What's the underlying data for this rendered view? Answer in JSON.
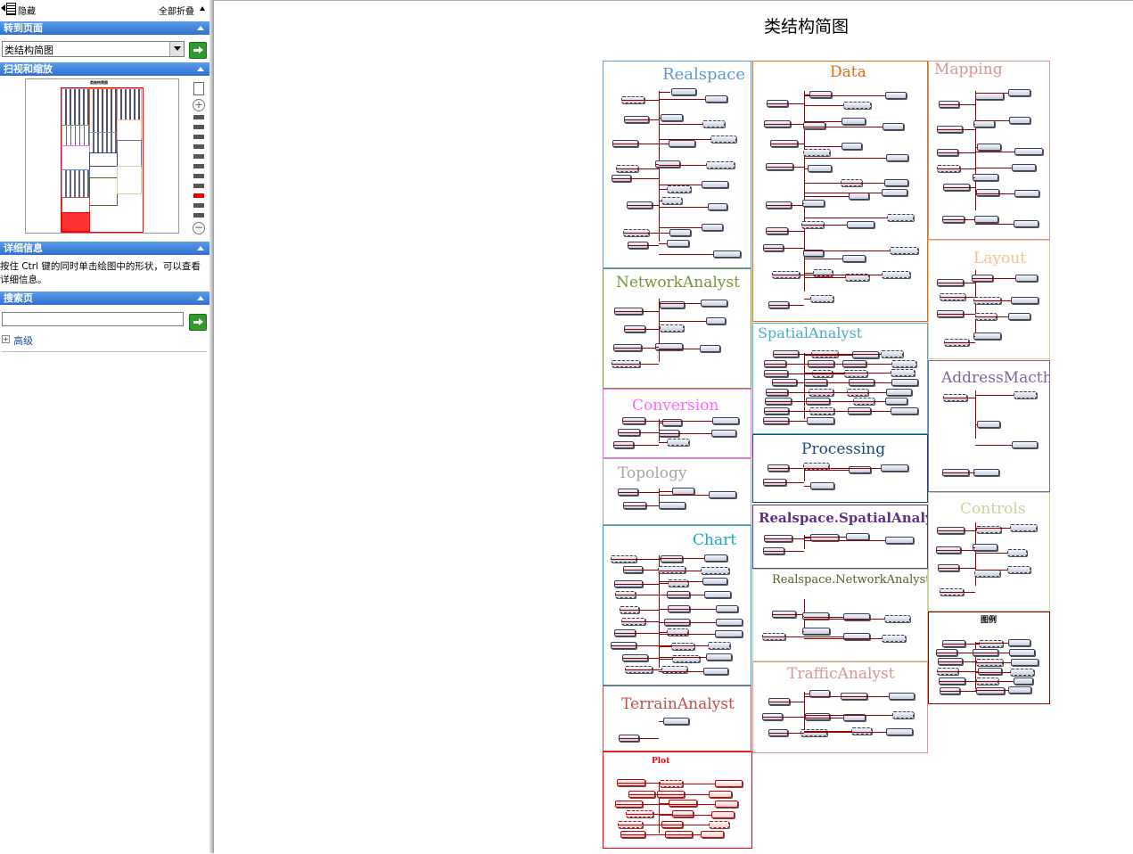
{
  "topbar": {
    "hide_label": "隐藏",
    "collapse_all_label": "全部折叠"
  },
  "goto_section": {
    "header": "转到页面",
    "selected_page": "类结构简图"
  },
  "scan_section": {
    "header": "扫视和缩放",
    "thumb_title": "类结构简图"
  },
  "detail_section": {
    "header": "详细信息",
    "help_text": "按住 Ctrl 键的同时单击绘图中的形状，可以查看详细信息。"
  },
  "search_section": {
    "header": "搜索页",
    "query": "",
    "advanced_label": "高级"
  },
  "diagram": {
    "title": "类结构简图",
    "panels": [
      {
        "name": "Realspace",
        "color": "#5b9bd5"
      },
      {
        "name": "Data",
        "color": "#e36c0a"
      },
      {
        "name": "Mapping",
        "color": "#d99694"
      },
      {
        "name": "NetworkAnalyst",
        "color": "#77933c"
      },
      {
        "name": "Layout",
        "color": "#fabf8f"
      },
      {
        "name": "SpatialAnalyst",
        "color": "#4bacc6"
      },
      {
        "name": "AddressMacth",
        "color": "#8064a2"
      },
      {
        "name": "Conversion",
        "color": "#ff66ff"
      },
      {
        "name": "Processing",
        "color": "#1f497d"
      },
      {
        "name": "Topology",
        "color": "#a5a5a5"
      },
      {
        "name": "Realspace.SpatialAnalyst",
        "color": "#5f2f86"
      },
      {
        "name": "Controls",
        "color": "#c3d69b"
      },
      {
        "name": "Chart",
        "color": "#17a8c8"
      },
      {
        "name": "Realspace.NetworkAnalyst",
        "color": "#4f6228"
      },
      {
        "name": "TrafficAnalyst",
        "color": "#d99694"
      },
      {
        "name": "TerrainAnalyst",
        "color": "#c0504d"
      },
      {
        "name": "Plot",
        "color": "#ff0000"
      }
    ],
    "legend_title": "图例"
  }
}
